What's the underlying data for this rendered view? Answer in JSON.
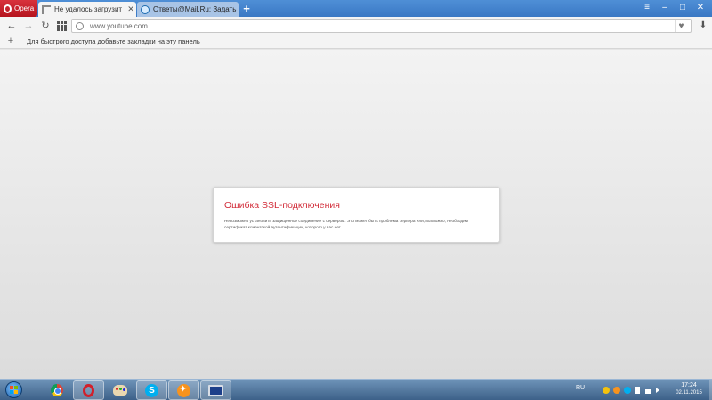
{
  "browser": {
    "menu_label": "Opera",
    "tabs": [
      {
        "label": "Не удалось загрузить htt",
        "active": true
      },
      {
        "label": "Ответы@Mail.Ru: Задать",
        "active": false
      }
    ],
    "new_tab_symbol": "+",
    "window_controls": {
      "tabs_menu": "≡",
      "minimize": "–",
      "maximize": "□",
      "close": "✕"
    }
  },
  "toolbar": {
    "back": "←",
    "forward": "→",
    "reload": "↻",
    "address_value": "www.youtube.com",
    "bookmark_symbol": "♥",
    "download_symbol": "⬇"
  },
  "bookmarks_bar": {
    "add_symbol": "+",
    "hint": "Для быстрого доступа добавьте закладки на эту панель"
  },
  "error": {
    "title": "Ошибка SSL-подключения",
    "message": "Невозможно установить защищенное соединение с сервером. Это может быть проблема сервера или, возможно, необходим сертификат клиентской аутентификации, которого у вас нет."
  },
  "taskbar": {
    "apps": [
      "chrome-icon",
      "opera-icon",
      "paint-icon",
      "skype-icon",
      "avast-icon",
      "computer-icon"
    ],
    "skype_letter": "S",
    "language": "RU",
    "time": "17:24",
    "date": "02.11.2015"
  },
  "colors": {
    "error_title": "#d22d3a",
    "opera_red": "#b5141e",
    "tab_strip": "#3a78c4",
    "taskbar": "#3d6189"
  }
}
